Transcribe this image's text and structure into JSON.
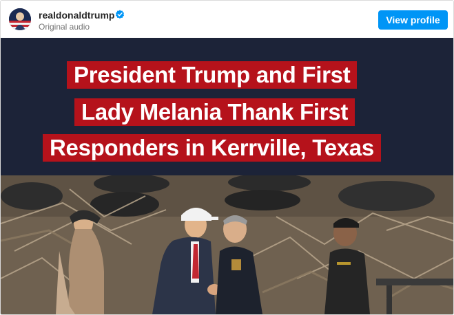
{
  "post": {
    "username": "realdonaldtrump",
    "subtitle": "Original audio",
    "view_profile_label": "View profile"
  },
  "video": {
    "caption_lines": [
      "President Trump and First",
      "Lady Melania Thank First",
      "Responders in Kerrville, Texas"
    ],
    "cap_text": "45"
  },
  "colors": {
    "accent": "#0095f6",
    "caption_red": "#b5121b",
    "verified": "#0095f6"
  },
  "icons": [
    "verified-badge-icon"
  ]
}
